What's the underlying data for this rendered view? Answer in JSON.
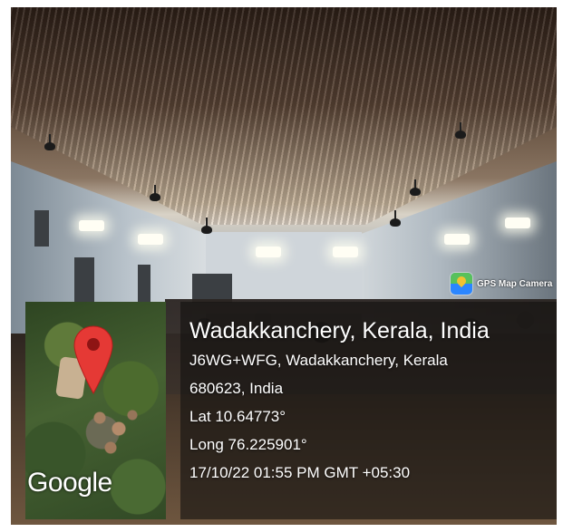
{
  "badge": {
    "label": "GPS Map Camera",
    "icon": "gps-map-camera-icon",
    "accent": "#2b86ff"
  },
  "map": {
    "logo_text": "Google",
    "pin_color": "#e53935",
    "pin_icon": "map-pin-icon"
  },
  "location": {
    "title": "Wadakkanchery, Kerala, India",
    "address_line1": "J6WG+WFG, Wadakkanchery, Kerala",
    "address_line2": "680623, India",
    "latitude": "Lat 10.64773°",
    "longitude": "Long 76.225901°",
    "timestamp": "17/10/22 01:55 PM GMT +05:30"
  }
}
